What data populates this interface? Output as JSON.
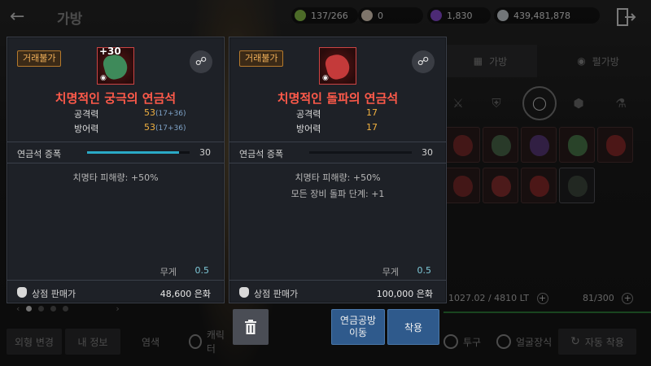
{
  "header": {
    "title": "가방",
    "back_icon": "arrow-left-icon",
    "exit_icon": "exit-door-icon",
    "currencies": [
      {
        "icon": "green-stone-icon",
        "value": "137/266",
        "color": "#8bc34a"
      },
      {
        "icon": "pearl-icon",
        "value": "0",
        "color": "#e6d5c3"
      },
      {
        "icon": "purple-orb-icon",
        "value": "1,830",
        "color": "#8a4dd6"
      },
      {
        "icon": "silver-coin-icon",
        "value": "439,481,878",
        "color": "#cfd8dc"
      }
    ]
  },
  "inventory": {
    "tabs": [
      "가방",
      "펄가방"
    ],
    "active_tab": 0,
    "filter_icons": [
      "crossed-swords-icon",
      "armor-icon",
      "ring-icon",
      "gem-icon",
      "potion-icon"
    ],
    "weight_text": "1027.02 / 4810 LT",
    "slot_count": "81/300"
  },
  "bottom_bar": {
    "buttons": [
      "외형 변경",
      "내 정보",
      "염색"
    ],
    "checks": [
      "캐릭터",
      "투구",
      "얼굴장식"
    ],
    "auto_equip": "자동 착용"
  },
  "cards": [
    {
      "badge": "거래불가",
      "enhance": "+30",
      "name": "치명적인 궁극의 연금석",
      "stats": [
        {
          "label": "공격력",
          "value": "53",
          "detail": "(17+36)"
        },
        {
          "label": "방어력",
          "value": "53",
          "detail": "(17+36)"
        }
      ],
      "section_label": "연금석 증폭",
      "section_value": "30",
      "section_fill": 0.9,
      "section_color": "#2aa9c6",
      "effects": [
        "치명타 피해량: +50%"
      ],
      "weight_label": "무게",
      "weight_value": "0.5",
      "price_label": "상점 판매가",
      "price_value": "48,600 은화",
      "link_icon": "link-icon",
      "stone_color": "#3e8a5a"
    },
    {
      "badge": "거래불가",
      "enhance": "",
      "name": "치명적인 돌파의 연금석",
      "stats": [
        {
          "label": "공격력",
          "value": "17",
          "detail": ""
        },
        {
          "label": "방어력",
          "value": "17",
          "detail": ""
        }
      ],
      "section_label": "연금석 증폭",
      "section_value": "30",
      "section_fill": 1.0,
      "section_color": "#111318",
      "effects": [
        "치명타 피해량: +50%",
        "모든 장비 돌파 단계: +1"
      ],
      "weight_label": "무게",
      "weight_value": "0.5",
      "price_label": "상점 판매가",
      "price_value": "100,000 은화",
      "link_icon": "link-icon",
      "stone_color": "#c43a3a"
    }
  ],
  "actions": {
    "delete_icon": "trash-icon",
    "workshop": "연금공방\n이동",
    "equip": "착용"
  },
  "slots": [
    {
      "color": "#7a2a2a"
    },
    {
      "color": "#4c6a4c"
    },
    {
      "color": "#5a3a7a"
    },
    {
      "color": "#4c7a4c"
    },
    {
      "color": "#8a2a2a"
    },
    {
      "color": "#7a2a2a"
    },
    {
      "color": "#8a3030"
    },
    {
      "color": "#8a2a2a"
    },
    {
      "color": "#3e4a3e"
    }
  ]
}
